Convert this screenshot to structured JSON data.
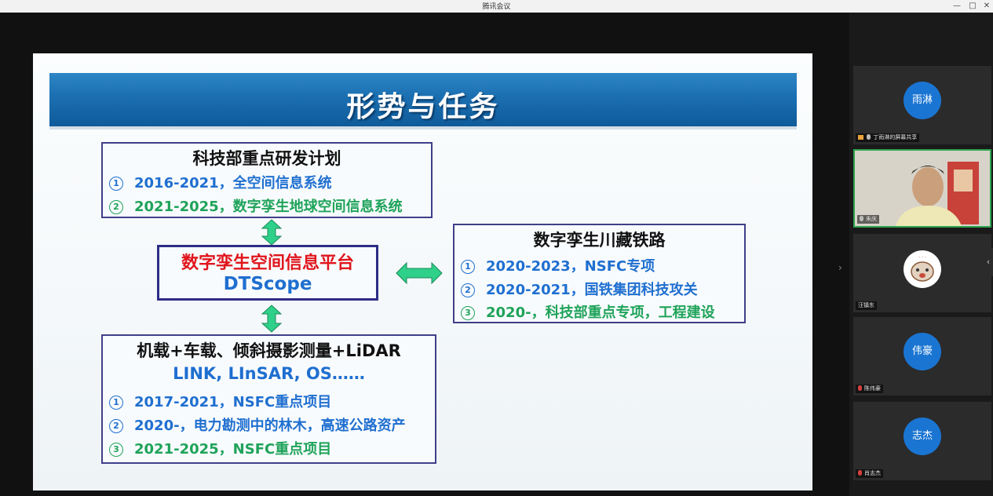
{
  "window": {
    "title": "腾讯会议",
    "controls": {
      "minimize": "—",
      "maximize": "□",
      "close": "✕"
    }
  },
  "slide": {
    "title": "形势与任务",
    "box1": {
      "heading": "科技部重点研发计划",
      "items": [
        {
          "num": "1",
          "text": "2016-2021，全空间信息系统",
          "color": "#1f6fd0"
        },
        {
          "num": "2",
          "text": "2021-2025，数字孪生地球空间信息系统",
          "color": "#1fa35a"
        }
      ]
    },
    "box2": {
      "line1": "数字孪生空间信息平台",
      "line2": "DTScope"
    },
    "box3": {
      "heading": "数字孪生川藏铁路",
      "items": [
        {
          "num": "1",
          "text": "2020-2023，NSFC专项",
          "color": "#1f6fd0"
        },
        {
          "num": "2",
          "text": "2020-2021，国铁集团科技攻关",
          "color": "#1f6fd0"
        },
        {
          "num": "3",
          "text": "2020-，科技部重点专项，工程建设",
          "color": "#1fa35a"
        }
      ]
    },
    "box4": {
      "heading": "机载+车载、倾斜摄影测量+LiDAR",
      "subheading": "LINK, LInSAR, OS……",
      "items": [
        {
          "num": "1",
          "text": "2017-2021，NSFC重点项目",
          "color": "#1f6fd0"
        },
        {
          "num": "2",
          "text": "2020-，电力勘测中的林木，高速公路资产",
          "color": "#1f6fd0"
        },
        {
          "num": "3",
          "text": "2021-2025，NSFC重点项目",
          "color": "#1fa35a"
        }
      ]
    },
    "arrow_color": "#2fd08a"
  },
  "participants": [
    {
      "avatar_text": "雨淋",
      "name": "丁雨淋的屏幕共享",
      "type": "avatar",
      "color": "#1a75d2"
    },
    {
      "avatar_text": "",
      "name": "朱庆",
      "type": "video"
    },
    {
      "avatar_text": "",
      "name": "汪镇东",
      "type": "image"
    },
    {
      "avatar_text": "伟豪",
      "name": "陈伟豪",
      "type": "avatar",
      "color": "#1a75d2"
    },
    {
      "avatar_text": "志杰",
      "name": "肖志杰",
      "type": "avatar",
      "color": "#1a75d2"
    }
  ]
}
